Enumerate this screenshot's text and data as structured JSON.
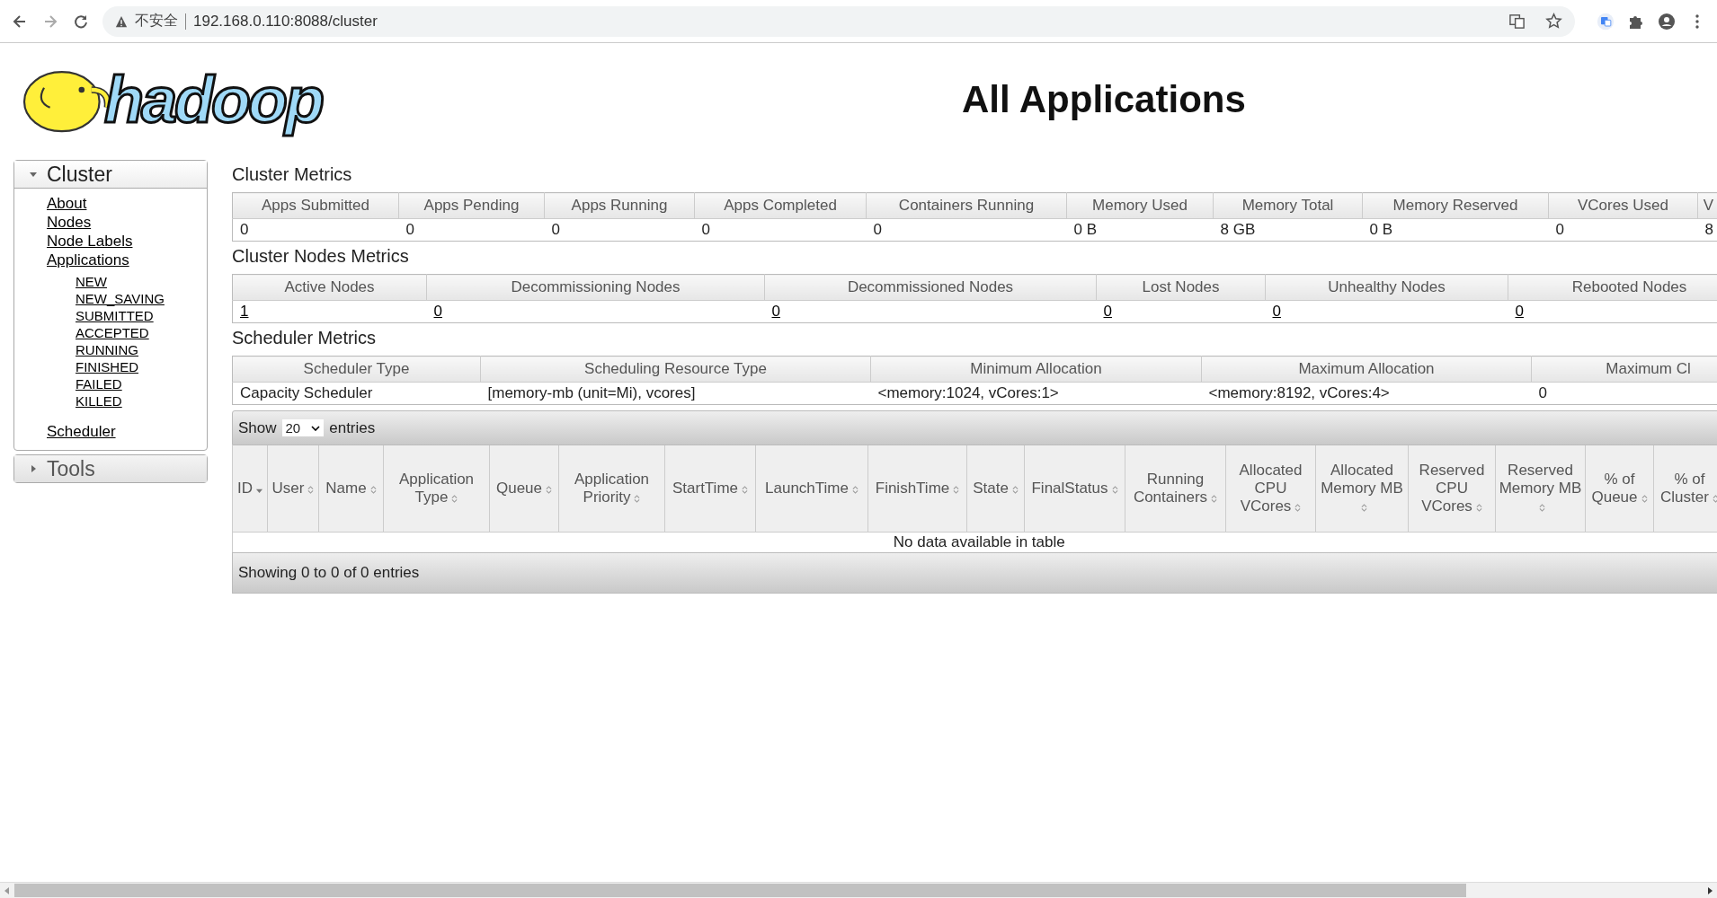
{
  "browser": {
    "security_label": "不安全",
    "url": "192.168.0.110:8088/cluster"
  },
  "logo": {
    "text": "hadoop"
  },
  "page_title": "All Applications",
  "sidebar": [
    {
      "label": "Cluster",
      "expanded": true,
      "items": [
        {
          "label": "About"
        },
        {
          "label": "Nodes"
        },
        {
          "label": "Node Labels"
        },
        {
          "label": "Applications",
          "children": [
            {
              "label": "NEW"
            },
            {
              "label": "NEW_SAVING"
            },
            {
              "label": "SUBMITTED"
            },
            {
              "label": "ACCEPTED"
            },
            {
              "label": "RUNNING"
            },
            {
              "label": "FINISHED"
            },
            {
              "label": "FAILED"
            },
            {
              "label": "KILLED"
            }
          ]
        },
        {
          "label": "Scheduler"
        }
      ]
    },
    {
      "label": "Tools",
      "expanded": false
    }
  ],
  "metrics": [
    {
      "title": "Cluster Metrics",
      "columns": [
        "Apps Submitted",
        "Apps Pending",
        "Apps Running",
        "Apps Completed",
        "Containers Running",
        "Memory Used",
        "Memory Total",
        "Memory Reserved",
        "VCores Used",
        "V"
      ],
      "cells": [
        {
          "text": "0",
          "link": false
        },
        {
          "text": "0",
          "link": false
        },
        {
          "text": "0",
          "link": false
        },
        {
          "text": "0",
          "link": false
        },
        {
          "text": "0",
          "link": false
        },
        {
          "text": "0 B",
          "link": false
        },
        {
          "text": "8 GB",
          "link": false
        },
        {
          "text": "0 B",
          "link": false
        },
        {
          "text": "0",
          "link": false
        },
        {
          "text": "8",
          "link": false
        }
      ]
    },
    {
      "title": "Cluster Nodes Metrics",
      "columns": [
        "Active Nodes",
        "Decommissioning Nodes",
        "Decommissioned Nodes",
        "Lost Nodes",
        "Unhealthy Nodes",
        "Rebooted Nodes"
      ],
      "cells": [
        {
          "text": "1",
          "link": true
        },
        {
          "text": "0",
          "link": true
        },
        {
          "text": "0",
          "link": true
        },
        {
          "text": "0",
          "link": true
        },
        {
          "text": "0",
          "link": true
        },
        {
          "text": "0",
          "link": true
        }
      ]
    },
    {
      "title": "Scheduler Metrics",
      "columns": [
        "Scheduler Type",
        "Scheduling Resource Type",
        "Minimum Allocation",
        "Maximum Allocation",
        "Maximum Cl"
      ],
      "cells": [
        {
          "text": "Capacity Scheduler",
          "link": false
        },
        {
          "text": "[memory-mb (unit=Mi), vcores]",
          "link": false
        },
        {
          "text": "<memory:1024, vCores:1>",
          "link": false
        },
        {
          "text": "<memory:8192, vCores:4>",
          "link": false
        },
        {
          "text": "0",
          "link": false
        }
      ]
    }
  ],
  "apps_table": {
    "show_label": "Show",
    "page_size": "20",
    "entries_label": "entries",
    "columns": [
      {
        "label": "ID",
        "sorted": true
      },
      {
        "label": "User",
        "sorted": false
      },
      {
        "label": "Name",
        "sorted": false
      },
      {
        "label": "Application Type",
        "sorted": false
      },
      {
        "label": "Queue",
        "sorted": false
      },
      {
        "label": "Application Priority",
        "sorted": false
      },
      {
        "label": "StartTime",
        "sorted": false
      },
      {
        "label": "LaunchTime",
        "sorted": false
      },
      {
        "label": "FinishTime",
        "sorted": false
      },
      {
        "label": "State",
        "sorted": false
      },
      {
        "label": "FinalStatus",
        "sorted": false
      },
      {
        "label": "Running Containers",
        "sorted": false
      },
      {
        "label": "Allocated CPU VCores",
        "sorted": false
      },
      {
        "label": "Allocated Memory MB",
        "sorted": false
      },
      {
        "label": "Reserved CPU VCores",
        "sorted": false
      },
      {
        "label": "Reserved Memory MB",
        "sorted": false
      },
      {
        "label": "% of Queue",
        "sorted": false
      },
      {
        "label": "% of Cluster",
        "sorted": false
      }
    ],
    "empty_message": "No data available in table",
    "footer": "Showing 0 to 0 of 0 entries"
  }
}
